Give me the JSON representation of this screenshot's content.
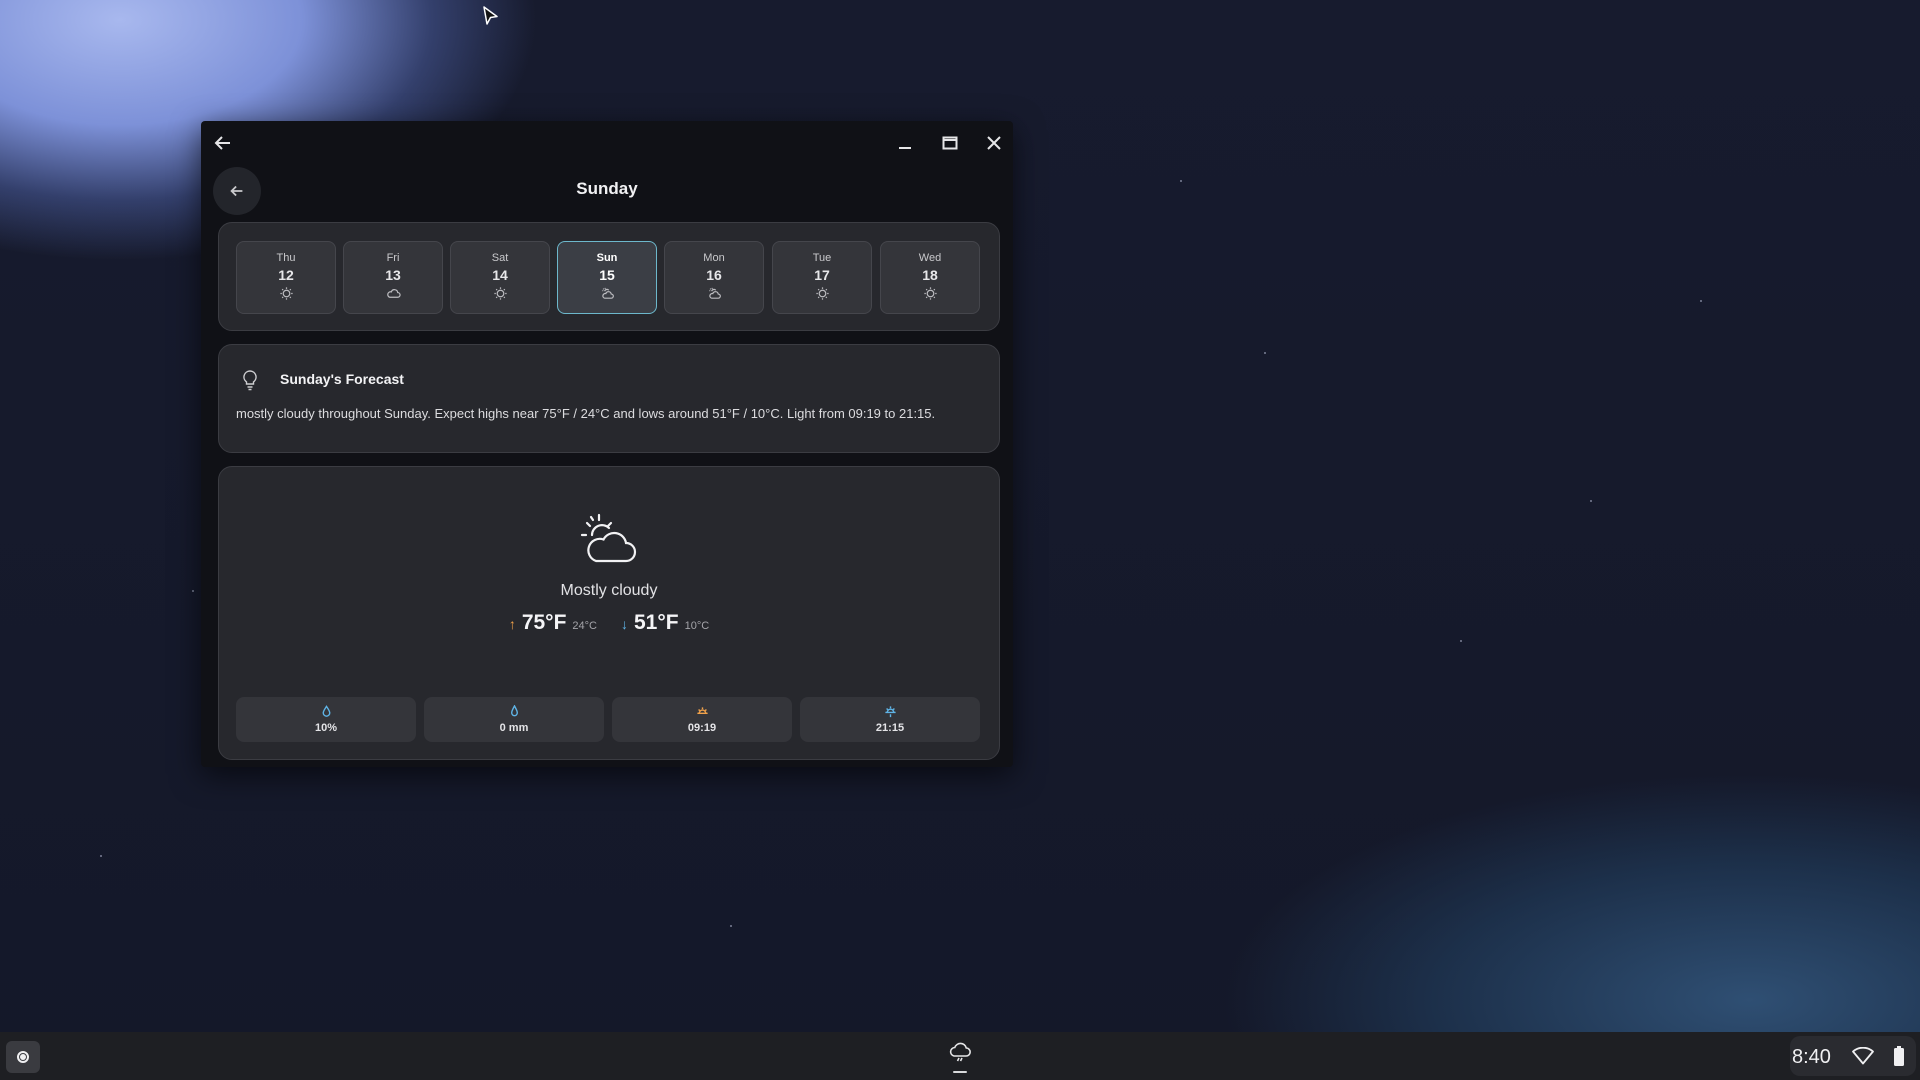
{
  "window": {
    "title": "Sunday"
  },
  "days": [
    {
      "name": "Thu",
      "date": "12",
      "icon": "sun-icon",
      "selected": false
    },
    {
      "name": "Fri",
      "date": "13",
      "icon": "cloud-icon",
      "selected": false
    },
    {
      "name": "Sat",
      "date": "14",
      "icon": "sun-icon",
      "selected": false
    },
    {
      "name": "Sun",
      "date": "15",
      "icon": "partly-cloudy-icon",
      "selected": true
    },
    {
      "name": "Mon",
      "date": "16",
      "icon": "partly-cloudy-icon",
      "selected": false
    },
    {
      "name": "Tue",
      "date": "17",
      "icon": "sun-icon",
      "selected": false
    },
    {
      "name": "Wed",
      "date": "18",
      "icon": "sun-icon",
      "selected": false
    }
  ],
  "forecast": {
    "title": "Sunday's Forecast",
    "text": "mostly cloudy throughout Sunday. Expect highs near 75°F / 24°C and lows around 51°F / 10°C. Light from 09:19 to 21:15.",
    "icon": "lightbulb-icon"
  },
  "today": {
    "condition": "Mostly cloudy",
    "icon": "partly-cloudy-icon",
    "high_f": "75°F",
    "high_c": "24°C",
    "low_f": "51°F",
    "low_c": "10°C",
    "high_arrow": "↑",
    "low_arrow": "↓"
  },
  "stats": [
    {
      "name": "precip-chance",
      "icon": "droplet-icon",
      "value": "10%",
      "color": "#5fb4e6"
    },
    {
      "name": "precip-amount",
      "icon": "raindrop-icon",
      "value": "0 mm",
      "color": "#5fb4e6"
    },
    {
      "name": "sunrise",
      "icon": "sunrise-icon",
      "value": "09:19",
      "color": "#f0a14a"
    },
    {
      "name": "sunset",
      "icon": "sunset-icon",
      "value": "21:15",
      "color": "#5fb4e6"
    }
  ],
  "taskbar": {
    "time": "8:40",
    "app_icon": "weather-app-icon"
  },
  "colors": {
    "accent": "#6db8cc",
    "high": "#f0a14a",
    "low": "#5fb4e6"
  }
}
